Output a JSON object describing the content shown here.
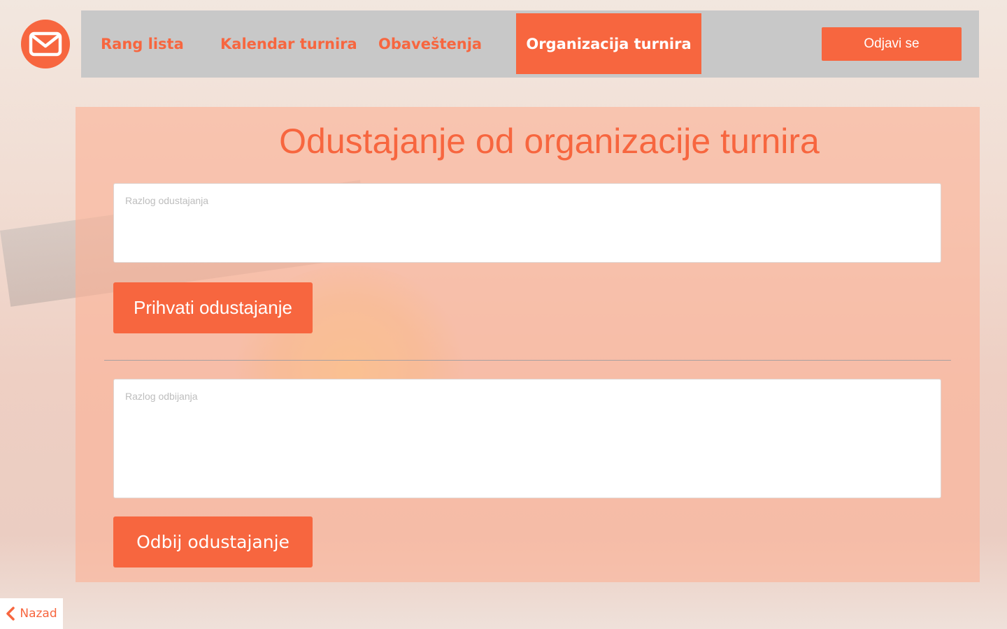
{
  "theme": {
    "accent": "#f7663f",
    "nav_background": "#c8c8c8",
    "panel_tint": "#fcb196"
  },
  "mail_button": {
    "icon": "envelope-icon"
  },
  "nav": {
    "items": [
      {
        "label": "Rang lista"
      },
      {
        "label": "Kalendar turnira"
      },
      {
        "label": "Obaveštenja"
      },
      {
        "label": "Organizacija turnira",
        "active": true
      }
    ],
    "logout_label": "Odjavi se"
  },
  "main": {
    "title": "Odustajanje od organizacije turnira",
    "withdrawal_reason": {
      "placeholder": "Razlog odustajanja",
      "value": ""
    },
    "accept_label": "Prihvati odustajanje",
    "rejection_reason": {
      "placeholder": "Razlog odbijanja",
      "value": ""
    },
    "reject_label": "Odbij odustajanje"
  },
  "back": {
    "label": "Nazad",
    "icon": "chevron-left-icon"
  }
}
